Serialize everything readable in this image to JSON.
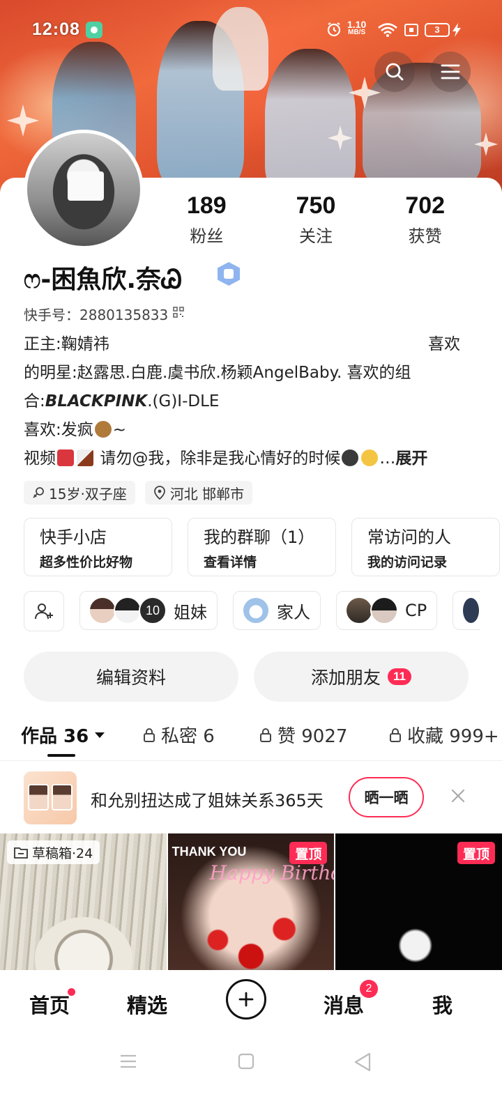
{
  "status_bar": {
    "time": "12:08",
    "net_speed": "1.10",
    "net_unit": "MB/S",
    "battery": "3",
    "icons": [
      "app-icon",
      "alarm-icon",
      "wifi-icon",
      "sim-icon",
      "battery-icon",
      "charging-icon"
    ]
  },
  "header": {
    "search_icon": "search-icon",
    "menu_icon": "menu-icon"
  },
  "profile": {
    "stats": [
      {
        "value": "189",
        "label": "粉丝"
      },
      {
        "value": "750",
        "label": "关注"
      },
      {
        "value": "702",
        "label": "获赞"
      }
    ],
    "name": "ෆ-困魚欣.奈Ꮚ",
    "id_label": "快手号：",
    "id_value": "2880135833",
    "bio": {
      "line1_left": "正主:鞠婧祎",
      "line1_right": "喜欢",
      "line2": "的明星:赵露思.白鹿.虞书欣.杨颖AngelBaby.   喜欢的组",
      "line3_prefix": "合:",
      "line3_bold": "BLACKPINK",
      "line3_rest": ".(G)I-DLE",
      "line4_text": "喜欢:发疯",
      "line4_tail": "~",
      "line5_a": "视频",
      "line5_b": "请勿@我，除非是我心情好的时候",
      "line5_c": "…",
      "expand": "展开"
    },
    "tags": [
      {
        "icon": "gender-female-icon",
        "text": "15岁·双子座"
      },
      {
        "icon": "location-pin-icon",
        "text": "河北 邯郸市"
      }
    ]
  },
  "feature_boxes": [
    {
      "title": "快手小店",
      "subtitle": "超多性价比好物"
    },
    {
      "title": "我的群聊（1）",
      "subtitle": "查看详情"
    },
    {
      "title": "常访问的人",
      "subtitle": "我的访问记录"
    }
  ],
  "circles": [
    {
      "count": "10",
      "label": "姐妹"
    },
    {
      "label": "家人"
    },
    {
      "label": "CP"
    }
  ],
  "buttons": {
    "edit_profile": "编辑资料",
    "add_friend": "添加朋友",
    "add_friend_count": "11"
  },
  "tabs": [
    {
      "label": "作品 36",
      "active": true
    },
    {
      "label": "私密 6",
      "locked": true
    },
    {
      "label": "赞 9027",
      "locked": true
    },
    {
      "label": "收藏 999+",
      "locked": true
    }
  ],
  "banner": {
    "message": "和允别扭达成了姐妹关系365天",
    "share_label": "晒一晒"
  },
  "grid": {
    "draft_label": "草稿箱·24",
    "pin_label": "置顶",
    "thank_you": "THANK YOU",
    "happy_text": "Happy Birthday"
  },
  "bottom_nav": {
    "home": "首页",
    "featured": "精选",
    "messages": "消息",
    "messages_badge": "2",
    "me": "我"
  },
  "colors": {
    "accent": "#fe2c55",
    "text": "#222222",
    "chip_bg": "#f4f4f5"
  }
}
